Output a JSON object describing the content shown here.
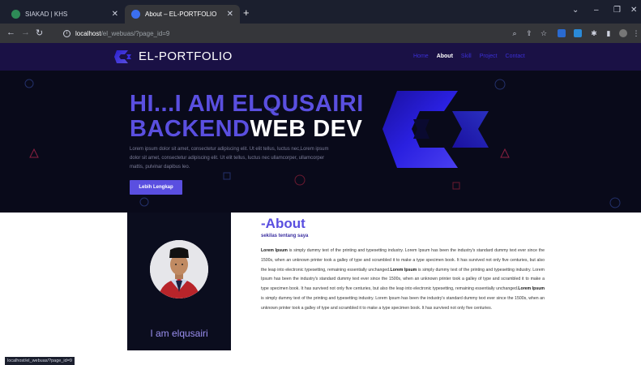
{
  "browser": {
    "tabs": [
      {
        "title": "SIAKAD | KHS",
        "favicon_color": "#2e8b57"
      },
      {
        "title": "About – EL-PORTFOLIO",
        "favicon_color": "#3b6ff0"
      }
    ],
    "url_host": "localhost",
    "url_path": "/el_webuas/?page_id=9",
    "status_url": "localhost/el_webuas/?page_id=9"
  },
  "site": {
    "brand": "EL-PORTFOLIO",
    "menu": [
      "Home",
      "About",
      "Skill",
      "Project",
      "Contact"
    ],
    "active_menu": "About"
  },
  "hero": {
    "line1": "HI...I AM ELQUSAIRI",
    "line2_accent": "BACKEND",
    "line2_rest": "WEB DEV",
    "description": "Lorem ipsum dolor sit amet, consectetur adipiscing elit. Ut elit tellus, luctus nec,Lorem ipsum dolor sit amet, consectetur adipiscing elit. Ut elit tellus, luctus nec ullamcorper, ullamcorper mattis, pulvinar dapibus leo.",
    "button_label": "Lebih Lengkap"
  },
  "about": {
    "title": "-About",
    "subtitle": "sekilas tentang saya",
    "name": "I am elqusairi",
    "body": [
      {
        "b": "Lorem Ipsum"
      },
      {
        "t": " is simply dummy text of the printing and typesetting industry. Lorem Ipsum has been the industry's standard dummy text ever since the 1500s, when an unknown printer took a galley of type and scrambled it to make a type specimen book. It has survived not only five centuries, but also the leap into electronic typesetting, remaining essentially unchanged."
      },
      {
        "b": "Lorem Ipsum"
      },
      {
        "t": " is simply dummy text of the printing and typesetting industry. Lorem Ipsum has been the industry's standard dummy text ever since the 1500s, when an unknown printer took a galley of type and scrambled it to make a type specimen book. It has survived not only five centuries, but also the leap into electronic typesetting, remaining essentially unchanged."
      },
      {
        "b": "Lorem Ipsum"
      },
      {
        "t": " is simply dummy text of the printing and typesetting industry. Lorem Ipsum has been the industry's standard dummy text ever since the 1500s, when an unknown printer took a galley of type and scrambled it to make a type specimen book. It has survived not only five centuries."
      }
    ]
  },
  "colors": {
    "accent": "#5a4fe0",
    "header_bg": "#1a1145",
    "hero_bg": "#090a1a"
  }
}
